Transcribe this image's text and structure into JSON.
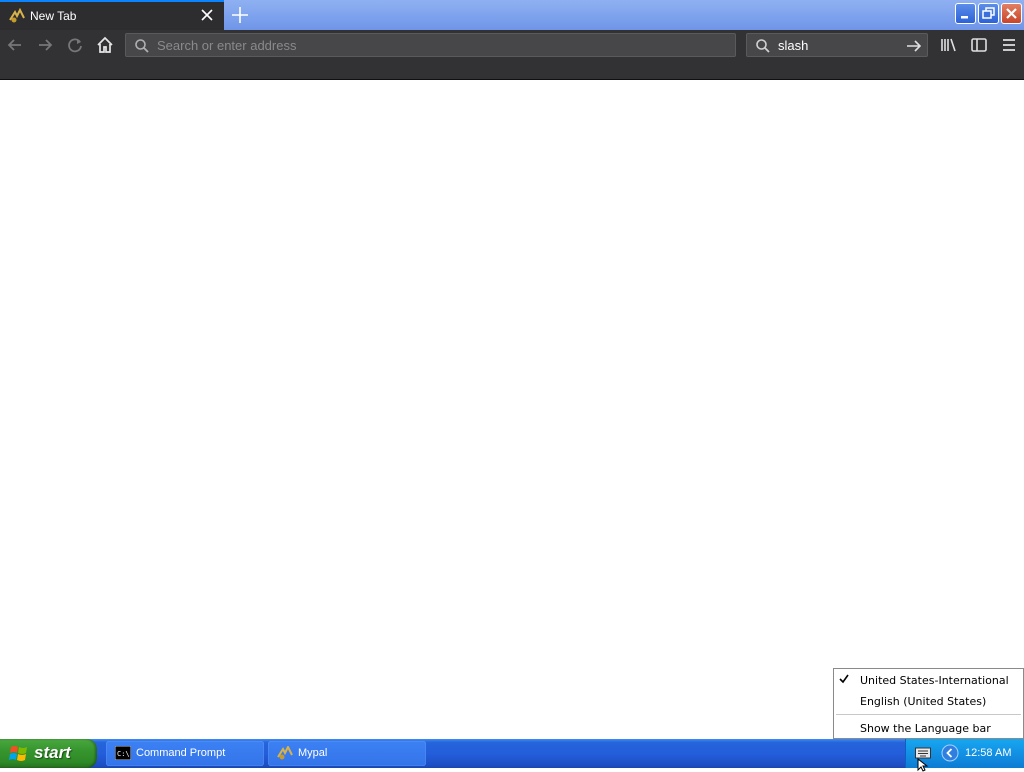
{
  "browser": {
    "tab": {
      "title": "New Tab"
    },
    "urlbar": {
      "placeholder": "Search or enter address",
      "value": ""
    },
    "searchbar": {
      "value": "slash"
    }
  },
  "language_menu": {
    "items": [
      {
        "label": "United States-International",
        "checked": true
      },
      {
        "label": "English (United States)",
        "checked": false
      },
      {
        "label": "Show the Language bar",
        "checked": false
      }
    ]
  },
  "taskbar": {
    "start_label": "start",
    "tasks": [
      {
        "label": "Command Prompt",
        "icon": "cmd-icon"
      },
      {
        "label": "Mypal",
        "icon": "mypal-icon"
      }
    ],
    "clock": "12:58 AM"
  },
  "colors": {
    "chrome_bg": "#323234",
    "tab_accent": "#0a84ff",
    "taskbar_blue": "#245edb",
    "start_green": "#37952f"
  }
}
